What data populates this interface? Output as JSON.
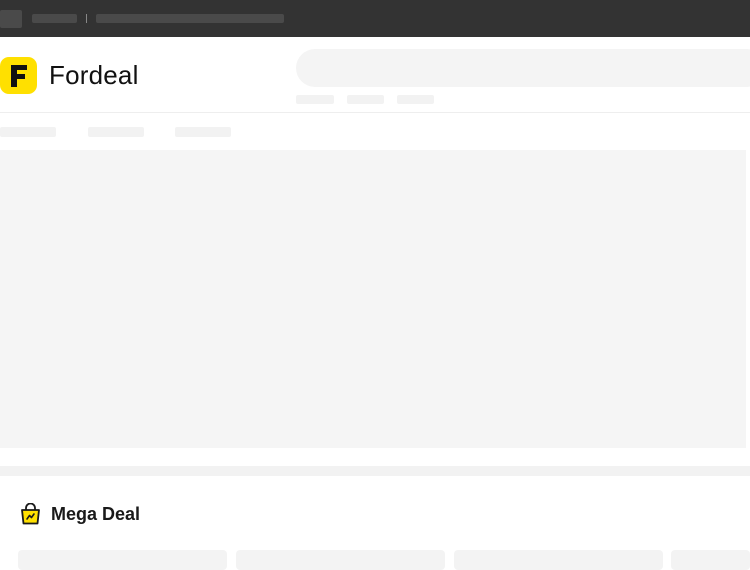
{
  "brand": {
    "name": "Fordeal",
    "logo_letter": "F",
    "accent_color": "#ffe000"
  },
  "search": {
    "placeholder": ""
  },
  "sections": [
    {
      "title": "Mega Deal",
      "icon": "shopping-bag-icon"
    }
  ]
}
